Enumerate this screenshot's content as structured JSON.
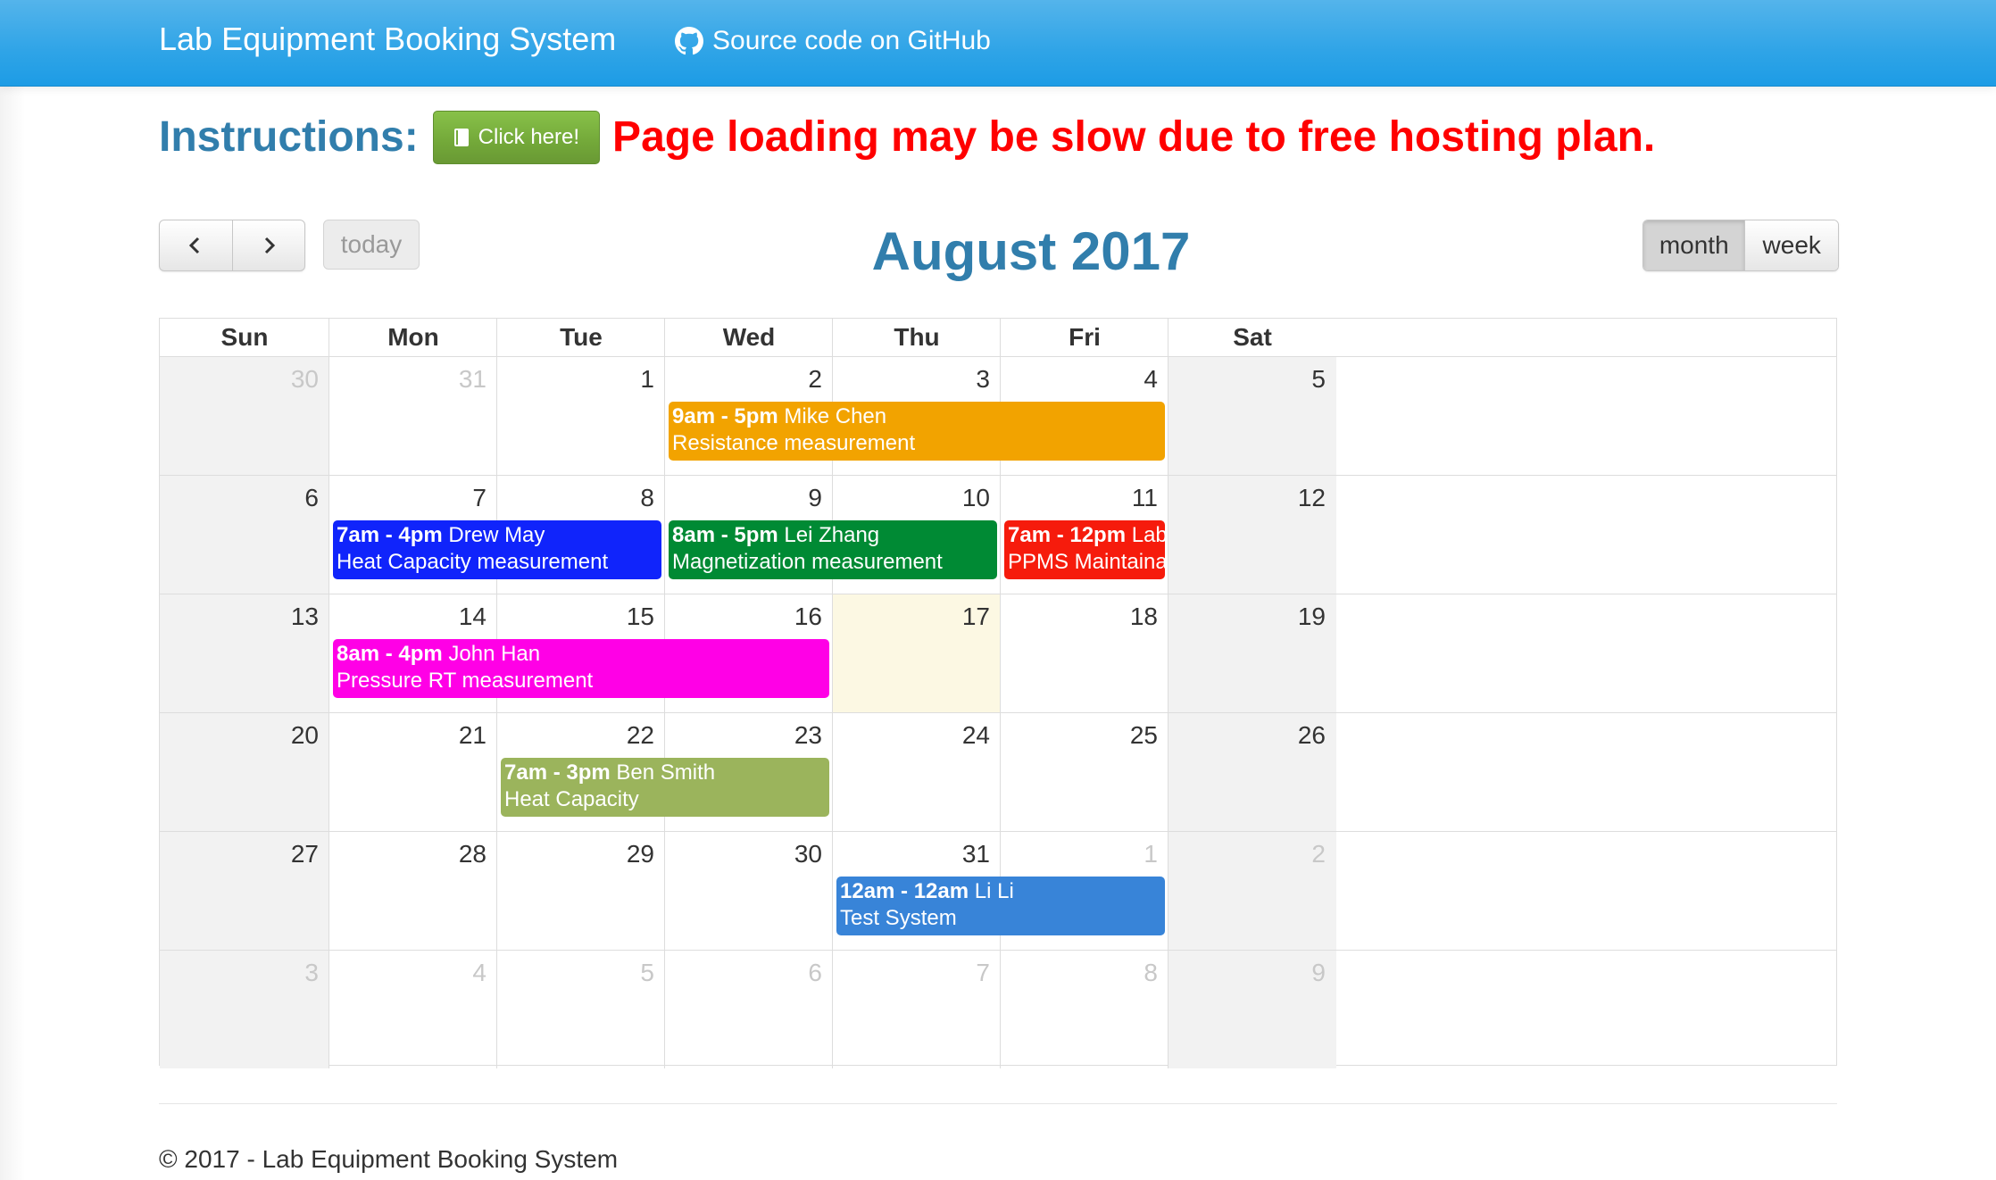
{
  "navbar": {
    "brand": "Lab Equipment Booking System",
    "github_link": "Source code on GitHub",
    "github_icon": "github-icon"
  },
  "notice": {
    "instructions_label": "Instructions:",
    "click_button": "Click here!",
    "book_icon": "book-icon",
    "slow_message": "Page loading may be slow due to free hosting plan."
  },
  "toolbar": {
    "prev_icon": "chevron-left-icon",
    "next_icon": "chevron-right-icon",
    "today": "today",
    "title": "August 2017",
    "views": [
      "month",
      "week"
    ],
    "active_view": "month"
  },
  "calendar": {
    "day_headers": [
      "Sun",
      "Mon",
      "Tue",
      "Wed",
      "Thu",
      "Fri",
      "Sat"
    ],
    "today_date": "17",
    "weeks": [
      [
        "30",
        "31",
        "1",
        "2",
        "3",
        "4",
        "5"
      ],
      [
        "6",
        "7",
        "8",
        "9",
        "10",
        "11",
        "12"
      ],
      [
        "13",
        "14",
        "15",
        "16",
        "17",
        "18",
        "19"
      ],
      [
        "20",
        "21",
        "22",
        "23",
        "24",
        "25",
        "26"
      ],
      [
        "27",
        "28",
        "29",
        "30",
        "31",
        "1",
        "2"
      ],
      [
        "3",
        "4",
        "5",
        "6",
        "7",
        "8",
        "9"
      ]
    ],
    "events": [
      {
        "time": "9am - 5pm",
        "person": "Mike Chen",
        "title": "Resistance measurement",
        "color": "#f2a300",
        "start": "2017-08-02",
        "end": "2017-08-04"
      },
      {
        "time": "7am - 4pm",
        "person": "Drew May",
        "title": "Heat Capacity measurement",
        "color": "#1024fb",
        "start": "2017-08-07",
        "end": "2017-08-08"
      },
      {
        "time": "8am - 5pm",
        "person": "Lei Zhang",
        "title": "Magnetization measurement",
        "color": "#008a34",
        "start": "2017-08-09",
        "end": "2017-08-10"
      },
      {
        "time": "7am - 12pm",
        "person": "Lab Manager",
        "title": "PPMS Maintainance",
        "color": "#f61b0c",
        "start": "2017-08-11",
        "end": "2017-08-11"
      },
      {
        "time": "8am - 4pm",
        "person": "John Han",
        "title": "Pressure RT measurement",
        "color": "#ff00e6",
        "start": "2017-08-14",
        "end": "2017-08-16"
      },
      {
        "time": "7am - 3pm",
        "person": "Ben Smith",
        "title": "Heat Capacity",
        "color": "#9bb45c",
        "start": "2017-08-22",
        "end": "2017-08-23"
      },
      {
        "time": "12am - 12am",
        "person": "Li Li",
        "title": "Test System",
        "color": "#3884d8",
        "start": "2017-08-31",
        "end": "2017-09-01"
      }
    ]
  },
  "footer": {
    "text": "© 2017 - Lab Equipment Booking System"
  }
}
